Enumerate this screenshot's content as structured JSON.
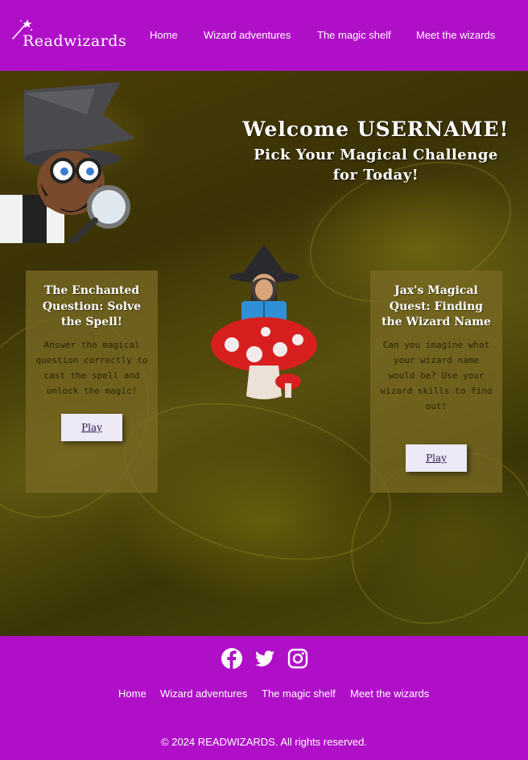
{
  "header": {
    "logo_text": "Readwizards",
    "nav": [
      "Home",
      "Wizard adventures",
      "The magic shelf",
      "Meet the wizards"
    ]
  },
  "main": {
    "welcome_title": "Welcome USERNAME!",
    "welcome_subtitle": "Pick Your Magical Challenge for Today!",
    "cards": [
      {
        "title": "The Enchanted Question: Solve the Spell!",
        "description": "Answer the magical question correctly to cast the spell and unlock the magic!",
        "button": "Play"
      },
      {
        "title": "Jax's Magical Quest: Finding the Wizard Name",
        "description": "Can you imagine what your wizard name would be? Use your wizard skills to find out!",
        "button": "Play"
      }
    ]
  },
  "footer": {
    "social_icons": [
      "facebook-icon",
      "twitter-icon",
      "instagram-icon"
    ],
    "nav": [
      "Home",
      "Wizard adventures",
      "The magic shelf",
      "Meet the wizards"
    ],
    "copyright": "© 2024 READWIZARDS. All rights reserved."
  },
  "colors": {
    "brand_purple": "#b00fc8",
    "card_bg": "#786923",
    "button_bg": "#eee9f7"
  }
}
